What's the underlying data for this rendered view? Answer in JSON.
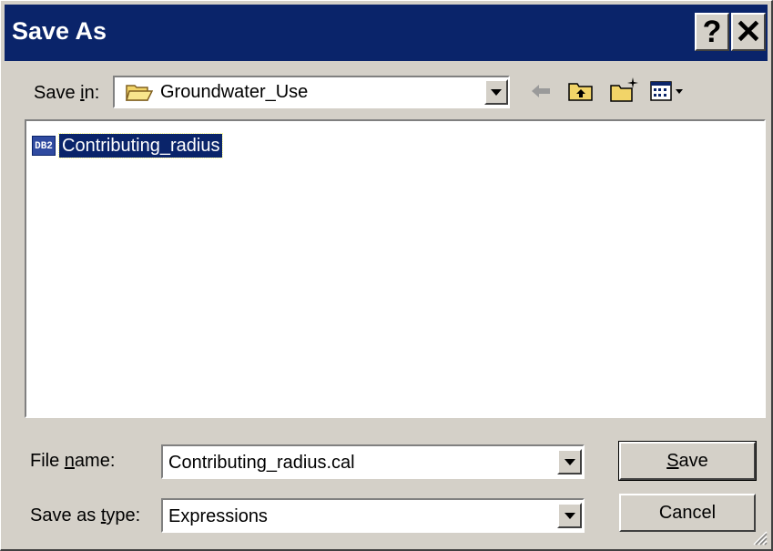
{
  "window": {
    "title": "Save As",
    "help_label": "?",
    "close_label": "✕"
  },
  "save_in": {
    "label_prefix": "Save ",
    "label_accel": "i",
    "label_suffix": "n:",
    "folder": "Groundwater_Use",
    "icons": [
      "back-arrow-icon",
      "up-folder-icon",
      "new-folder-icon",
      "view-menu-icon"
    ]
  },
  "files": [
    {
      "name": "Contributing_radius",
      "icon_text": "DB2",
      "selected": true
    }
  ],
  "file_name": {
    "label_prefix": "File ",
    "label_accel": "n",
    "label_suffix": "ame:",
    "value": "Contributing_radius.cal"
  },
  "save_type": {
    "label_prefix": "Save as ",
    "label_accel": "t",
    "label_suffix": "ype:",
    "value": "Expressions"
  },
  "buttons": {
    "save_accel": "S",
    "save_rest": "ave",
    "cancel": "Cancel"
  },
  "colors": {
    "titlebar": "#0a246a",
    "face": "#d4d0c8",
    "selection": "#0a246a"
  }
}
